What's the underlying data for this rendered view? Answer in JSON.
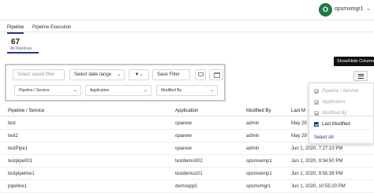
{
  "header": {
    "avatar_initial": "O",
    "username": "opsmxmgr1",
    "chevron": "⌄"
  },
  "tabs": [
    {
      "label": "Pipeline"
    },
    {
      "label": "Pipeline Execution"
    }
  ],
  "summary": {
    "count": "67",
    "label": "All Pipelines"
  },
  "filters": {
    "saved_filter_placeholder": "Select saved filter",
    "date_range": "Select date range",
    "filter_icon": "▼▾",
    "save_filter": "Save Filter",
    "pipeline_service": "Pipeline / Service",
    "application": "Application",
    "modified_by": "Modified By"
  },
  "columns_tooltip": "Show/Hide Columns",
  "column_panel": {
    "options": [
      {
        "label": "Pipeline / Service",
        "checked": true,
        "disabled": true
      },
      {
        "label": "Application",
        "checked": true,
        "disabled": true
      },
      {
        "label": "Modified By",
        "checked": true,
        "disabled": true
      },
      {
        "label": "Last Modified",
        "checked": true,
        "disabled": false
      }
    ],
    "select_all": "Select All"
  },
  "table": {
    "headers": [
      "Pipeline / Service",
      "Application",
      "Modified By",
      "Last M"
    ],
    "rows": [
      [
        "test",
        "opanew",
        "admin",
        "May 29"
      ],
      [
        "test2",
        "opanew",
        "admin",
        "May 29"
      ],
      [
        "testPipe1",
        "opanew",
        "admin",
        "Jun 1, 2020, 7:27:10 PM"
      ],
      [
        "testpipe001",
        "testdemo002",
        "opsmxemp1",
        "Jun 1, 2020, 9:34:50 PM"
      ],
      [
        "testpipeline1",
        "testdemo101",
        "opsmxemp1",
        "Jun 1, 2020, 9:55:39 PM"
      ],
      [
        "pipeline1",
        "demoapp1",
        "opsmxmgr1",
        "Jun 1, 2020, 10:55:20 PM"
      ]
    ]
  }
}
